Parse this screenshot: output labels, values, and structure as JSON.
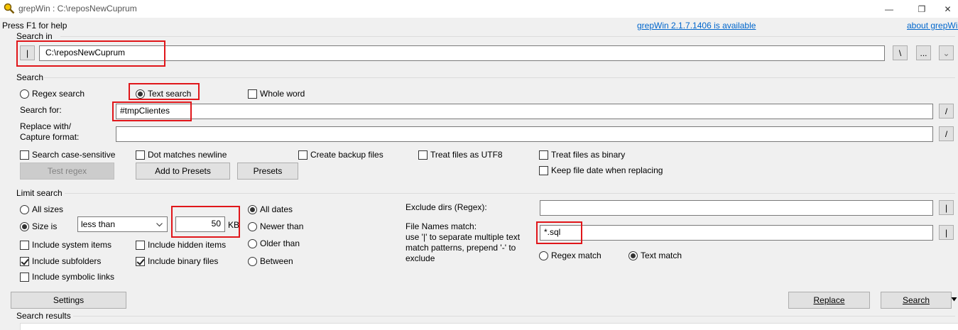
{
  "window": {
    "title": "grepWin : C:\\reposNewCuprum",
    "minimize": "—",
    "restore": "❐",
    "close": "✕"
  },
  "header": {
    "help": "Press F1 for help",
    "update_link": "grepWin 2.1.7.1406 is available",
    "about_link": "about grepWin"
  },
  "search_in": {
    "label": "Search in",
    "toggle": "|",
    "path": "C:\\reposNewCuprum",
    "backslash_btn": "\\",
    "browse_btn": "...",
    "dropdown_btn": "⌄"
  },
  "search": {
    "label": "Search",
    "regex_search": "Regex search",
    "text_search": "Text search",
    "whole_word": "Whole word",
    "search_for_label": "Search for:",
    "search_for_value": "#tmpClientes",
    "search_for_btn": "/",
    "replace_label_1": "Replace with/",
    "replace_label_2": "Capture format:",
    "replace_value": "",
    "replace_btn": "/",
    "case_sensitive": "Search case-sensitive",
    "dot_newline": "Dot matches newline",
    "backup_files": "Create backup files",
    "utf8": "Treat files as UTF8",
    "binary": "Treat files as binary",
    "keep_date": "Keep file date when replacing",
    "test_regex": "Test regex",
    "add_presets": "Add to Presets",
    "presets": "Presets"
  },
  "limit": {
    "label": "Limit search",
    "all_sizes": "All sizes",
    "size_is": "Size is",
    "size_op": "less than",
    "size_value": "50",
    "size_unit": "KB",
    "all_dates": "All dates",
    "newer_than": "Newer than",
    "older_than": "Older than",
    "between": "Between",
    "system_items": "Include system items",
    "hidden_items": "Include hidden items",
    "subfolders": "Include subfolders",
    "binary_files": "Include binary files",
    "symlinks": "Include symbolic links",
    "exclude_dirs_label": "Exclude dirs (Regex):",
    "exclude_dirs_value": "",
    "exclude_btn": "|",
    "names_label_1": "File Names match:",
    "names_label_2": "use '|' to separate multiple text",
    "names_label_3": "match patterns, prepend '-' to",
    "names_label_4": "exclude",
    "names_value": "*.sql",
    "names_btn": "|",
    "regex_match": "Regex match",
    "text_match": "Text match"
  },
  "footer": {
    "settings": "Settings",
    "replace": "Replace",
    "search": "Search",
    "results_label": "Search results"
  },
  "colors": {
    "highlight": "#e0161a",
    "link": "#0066cc"
  }
}
